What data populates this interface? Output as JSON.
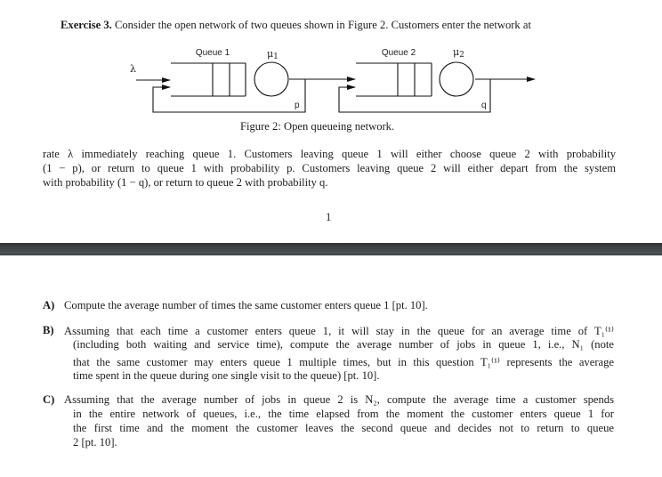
{
  "exercise": {
    "label": "Exercise 3.",
    "intro_line": "Consider the open network of two queues shown in Figure 2. Customers enter the network at",
    "continuation": [
      "rate λ immediately reaching queue 1. Customers leaving queue 1 will either choose queue 2 with probability",
      "(1 − p), or return to queue 1 with probability p. Customers leaving queue 2 will either depart from the system",
      "with probability (1 − q), or return to queue 2 with probability q."
    ]
  },
  "figure": {
    "queue1_label": "Queue 1",
    "queue2_label": "Queue 2",
    "mu1": "μ",
    "mu1_sub": "1",
    "mu2": "μ",
    "mu2_sub": "2",
    "lambda": "λ",
    "p_label": "p",
    "q_label": "q",
    "caption": "Figure 2: Open queueing network."
  },
  "page_number": "1",
  "questions": [
    {
      "label": "A)",
      "lines": [
        "Compute the average number of times the same customer enters queue 1 [pt. 10]."
      ]
    },
    {
      "label": "B)",
      "lines": [
        "Assuming that each time a customer enters queue 1, it will stay in the queue for an average time of T₁⁽¹⁾",
        "(including both waiting and service time), compute the average number of jobs in queue 1, i.e., N₁ (note",
        "that the same customer may enters queue 1 multiple times, but in this question T₁⁽¹⁾ represents the average",
        "time spent in the queue during one single visit to the queue) [pt. 10]."
      ]
    },
    {
      "label": "C)",
      "lines": [
        "Assuming that the average number of jobs in queue 2 is N₂, compute the average time a customer spends",
        "in the entire network of queues, i.e., the time elapsed from the moment the customer enters queue 1 for",
        "the first time and the moment the customer leaves the second queue and decides not to return to queue",
        "2 [pt. 10]."
      ]
    }
  ]
}
